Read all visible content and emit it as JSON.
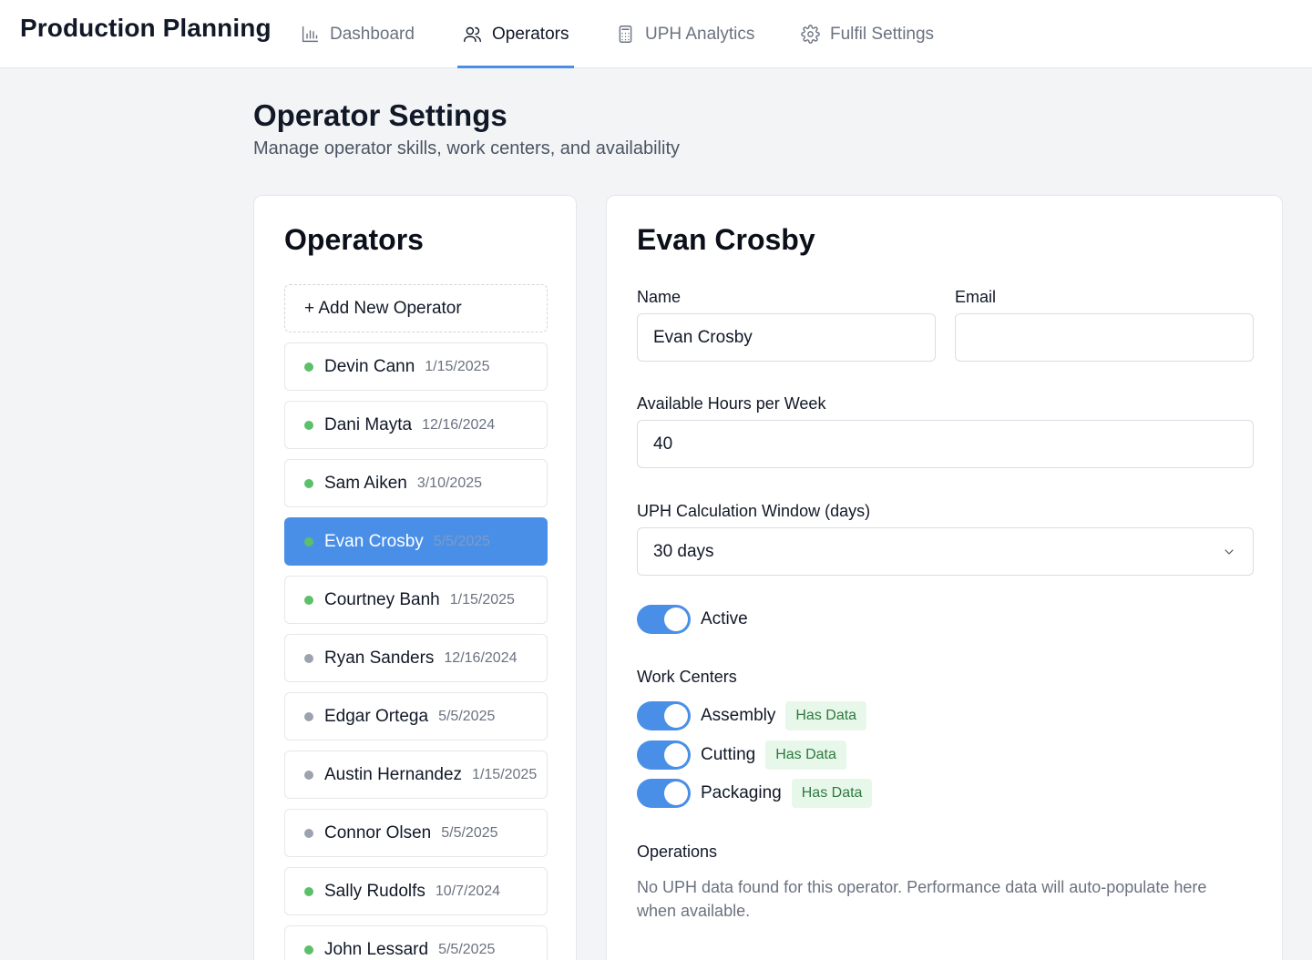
{
  "app": {
    "title": "Production Planning"
  },
  "nav": [
    {
      "label": "Dashboard",
      "icon": "bar-chart-icon",
      "active": false
    },
    {
      "label": "Operators",
      "icon": "users-icon",
      "active": true
    },
    {
      "label": "UPH Analytics",
      "icon": "calculator-icon",
      "active": false
    },
    {
      "label": "Fulfil Settings",
      "icon": "gear-icon",
      "active": false
    }
  ],
  "page": {
    "title": "Operator Settings",
    "subtitle": "Manage operator skills, work centers, and availability"
  },
  "operators_panel": {
    "title": "Operators",
    "add_label": "+ Add New Operator",
    "items": [
      {
        "name": "Devin Cann",
        "date": "1/15/2025",
        "active": true
      },
      {
        "name": "Dani Mayta",
        "date": "12/16/2024",
        "active": true
      },
      {
        "name": "Sam Aiken",
        "date": "3/10/2025",
        "active": true
      },
      {
        "name": "Evan Crosby",
        "date": "5/5/2025",
        "active": true,
        "selected": true
      },
      {
        "name": "Courtney Banh",
        "date": "1/15/2025",
        "active": true
      },
      {
        "name": "Ryan Sanders",
        "date": "12/16/2024",
        "active": false
      },
      {
        "name": "Edgar Ortega",
        "date": "5/5/2025",
        "active": false
      },
      {
        "name": "Austin Hernandez",
        "date": "1/15/2025",
        "active": false
      },
      {
        "name": "Connor Olsen",
        "date": "5/5/2025",
        "active": false
      },
      {
        "name": "Sally Rudolfs",
        "date": "10/7/2024",
        "active": true
      },
      {
        "name": "John Lessard",
        "date": "5/5/2025",
        "active": true
      }
    ]
  },
  "detail": {
    "title": "Evan Crosby",
    "name_label": "Name",
    "name_value": "Evan Crosby",
    "email_label": "Email",
    "email_value": "",
    "hours_label": "Available Hours per Week",
    "hours_value": "40",
    "window_label": "UPH Calculation Window (days)",
    "window_value": "30 days",
    "active_label": "Active",
    "active_on": true,
    "work_centers_label": "Work Centers",
    "work_centers": [
      {
        "name": "Assembly",
        "enabled": true,
        "badge": "Has Data"
      },
      {
        "name": "Cutting",
        "enabled": true,
        "badge": "Has Data"
      },
      {
        "name": "Packaging",
        "enabled": true,
        "badge": "Has Data"
      }
    ],
    "operations_label": "Operations",
    "operations_empty": "No UPH data found for this operator. Performance data will auto-populate here when available."
  },
  "colors": {
    "accent": "#4a8fe7",
    "status_active": "#5cbf6a",
    "status_inactive": "#9ca3af",
    "badge_bg": "#e7f7ea",
    "badge_text": "#2f7a3f"
  }
}
